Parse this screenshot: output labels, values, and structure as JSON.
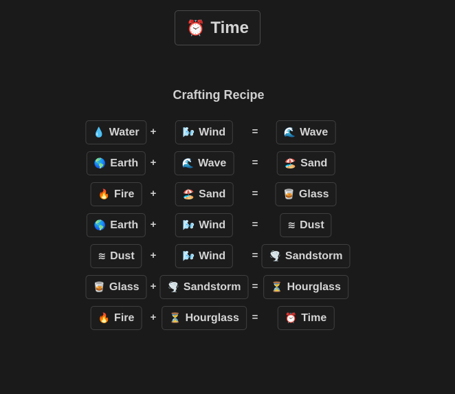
{
  "target": {
    "emoji": "⏰",
    "label": "Time"
  },
  "heading": "Crafting Recipe",
  "operators": {
    "plus": "+",
    "equals": "="
  },
  "recipes": [
    {
      "a": {
        "emoji": "💧",
        "label": "Water"
      },
      "b": {
        "emoji": "🌬️",
        "label": "Wind"
      },
      "result": {
        "emoji": "🌊",
        "label": "Wave"
      }
    },
    {
      "a": {
        "emoji": "🌎",
        "label": "Earth"
      },
      "b": {
        "emoji": "🌊",
        "label": "Wave"
      },
      "result": {
        "emoji": "🏖️",
        "label": "Sand"
      }
    },
    {
      "a": {
        "emoji": "🔥",
        "label": "Fire"
      },
      "b": {
        "emoji": "🏖️",
        "label": "Sand"
      },
      "result": {
        "emoji": "🥃",
        "label": "Glass"
      }
    },
    {
      "a": {
        "emoji": "🌎",
        "label": "Earth"
      },
      "b": {
        "emoji": "🌬️",
        "label": "Wind"
      },
      "result": {
        "emoji": "≋",
        "label": "Dust"
      }
    },
    {
      "a": {
        "emoji": "≋",
        "label": "Dust"
      },
      "b": {
        "emoji": "🌬️",
        "label": "Wind"
      },
      "result": {
        "emoji": "🌪️",
        "label": "Sandstorm"
      }
    },
    {
      "a": {
        "emoji": "🥃",
        "label": "Glass"
      },
      "b": {
        "emoji": "🌪️",
        "label": "Sandstorm"
      },
      "result": {
        "emoji": "⏳",
        "label": "Hourglass"
      }
    },
    {
      "a": {
        "emoji": "🔥",
        "label": "Fire"
      },
      "b": {
        "emoji": "⏳",
        "label": "Hourglass"
      },
      "result": {
        "emoji": "⏰",
        "label": "Time"
      }
    }
  ]
}
